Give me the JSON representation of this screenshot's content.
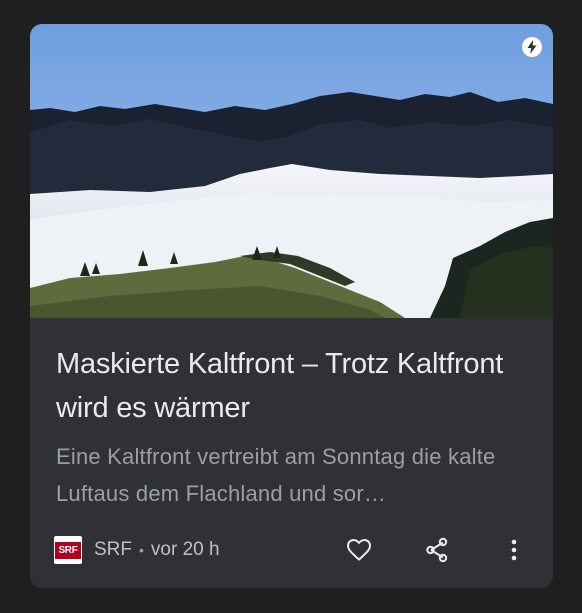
{
  "card": {
    "title": "Maskierte Kaltfront – Trotz Kaltfront wird es wärmer",
    "snippet": "Eine Kaltfront vertreibt am Sonntag die kalte Luftaus dem Flachland und sor…",
    "image_icon": "amp-lightning-icon",
    "source": {
      "logo_text": "SRF",
      "name": "SRF",
      "separator": "•",
      "time": "vor 20 h"
    },
    "actions": {
      "like_icon": "heart-outline-icon",
      "share_icon": "share-icon",
      "more_icon": "more-vert-icon"
    }
  },
  "colors": {
    "page_bg": "#1f1f1f",
    "card_bg": "#303134",
    "title": "#e8eaed",
    "snippet": "#9aa0a6",
    "srf_red": "#af001e"
  }
}
